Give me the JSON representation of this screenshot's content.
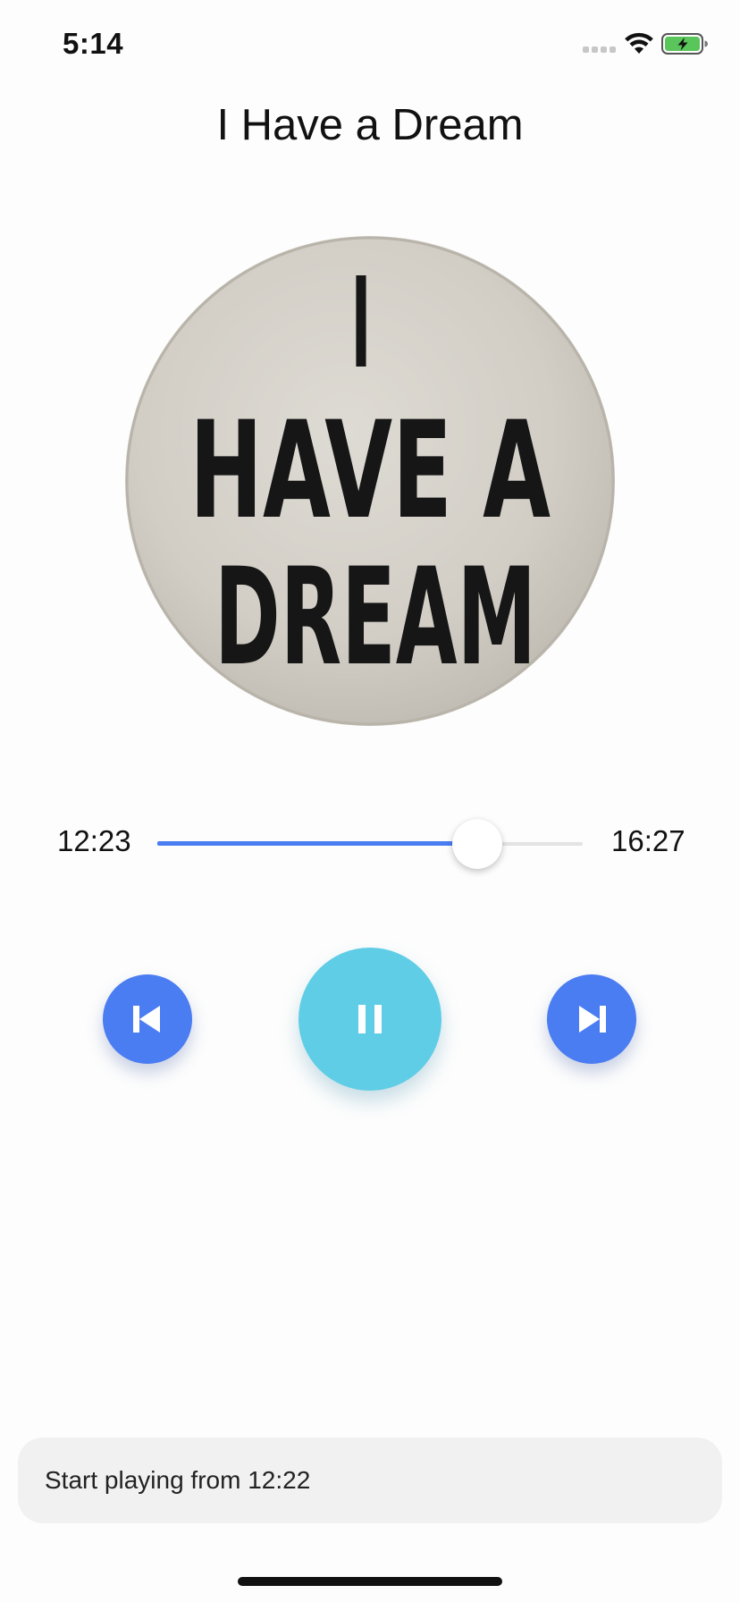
{
  "status_bar": {
    "time": "5:14",
    "icons": [
      "signal-icon",
      "wifi-icon",
      "battery-charging-icon"
    ],
    "battery_color": "#5ac55a"
  },
  "player": {
    "title": "I Have a Dream",
    "artwork": {
      "text_lines": [
        "I",
        "HAVE A",
        "DREAM"
      ]
    },
    "progress": {
      "elapsed": "12:23",
      "total": "16:27",
      "fraction": 0.753
    },
    "controls": {
      "previous_icon": "skip-previous-icon",
      "pause_icon": "pause-icon",
      "next_icon": "skip-next-icon"
    }
  },
  "toast": {
    "message": "Start playing from 12:22"
  },
  "colors": {
    "accent_blue": "#4a7cf2",
    "play_button": "#5ecde5",
    "toast_background": "#f1f1f1"
  }
}
